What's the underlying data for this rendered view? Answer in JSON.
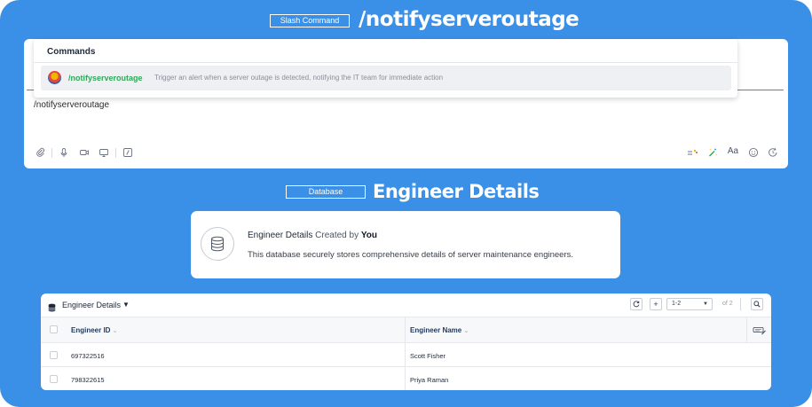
{
  "slash_section": {
    "tag": "Slash Command",
    "title": "/notifyserveroutage"
  },
  "composer": {
    "text": "/notifyserveroutage",
    "toolbar_left": [
      "attachment-icon",
      "microphone-icon",
      "video-icon",
      "screen-share-icon",
      "slash-command-icon"
    ],
    "toolbar_right": [
      "format-list-icon",
      "magic-wand-icon",
      "text-format-label",
      "emoji-icon",
      "schedule-icon"
    ],
    "text_format_label": "Aa"
  },
  "commands_popup": {
    "heading": "Commands",
    "items": [
      {
        "name": "/notifyserveroutage",
        "description": "Trigger an alert when a server outage is detected, notifying the IT team for immediate action"
      }
    ]
  },
  "database_section": {
    "tag": "Database",
    "title": "Engineer Details"
  },
  "database_card": {
    "name": "Engineer Details",
    "created_by_label": "Created by",
    "created_by": "You",
    "description": "This database securely stores comprehensive details of server maintenance engineers."
  },
  "table": {
    "name": "Engineer Details",
    "pagination_select": "1-2",
    "pagination_of": "of 2",
    "columns": [
      "Engineer ID",
      "Engineer Name"
    ],
    "rows": [
      {
        "id": "697322516",
        "name": "Scott Fisher"
      },
      {
        "id": "798322615",
        "name": "Priya Raman"
      }
    ]
  },
  "colors": {
    "background_blue": "#3a8fe6",
    "command_green": "#2fa85a"
  }
}
